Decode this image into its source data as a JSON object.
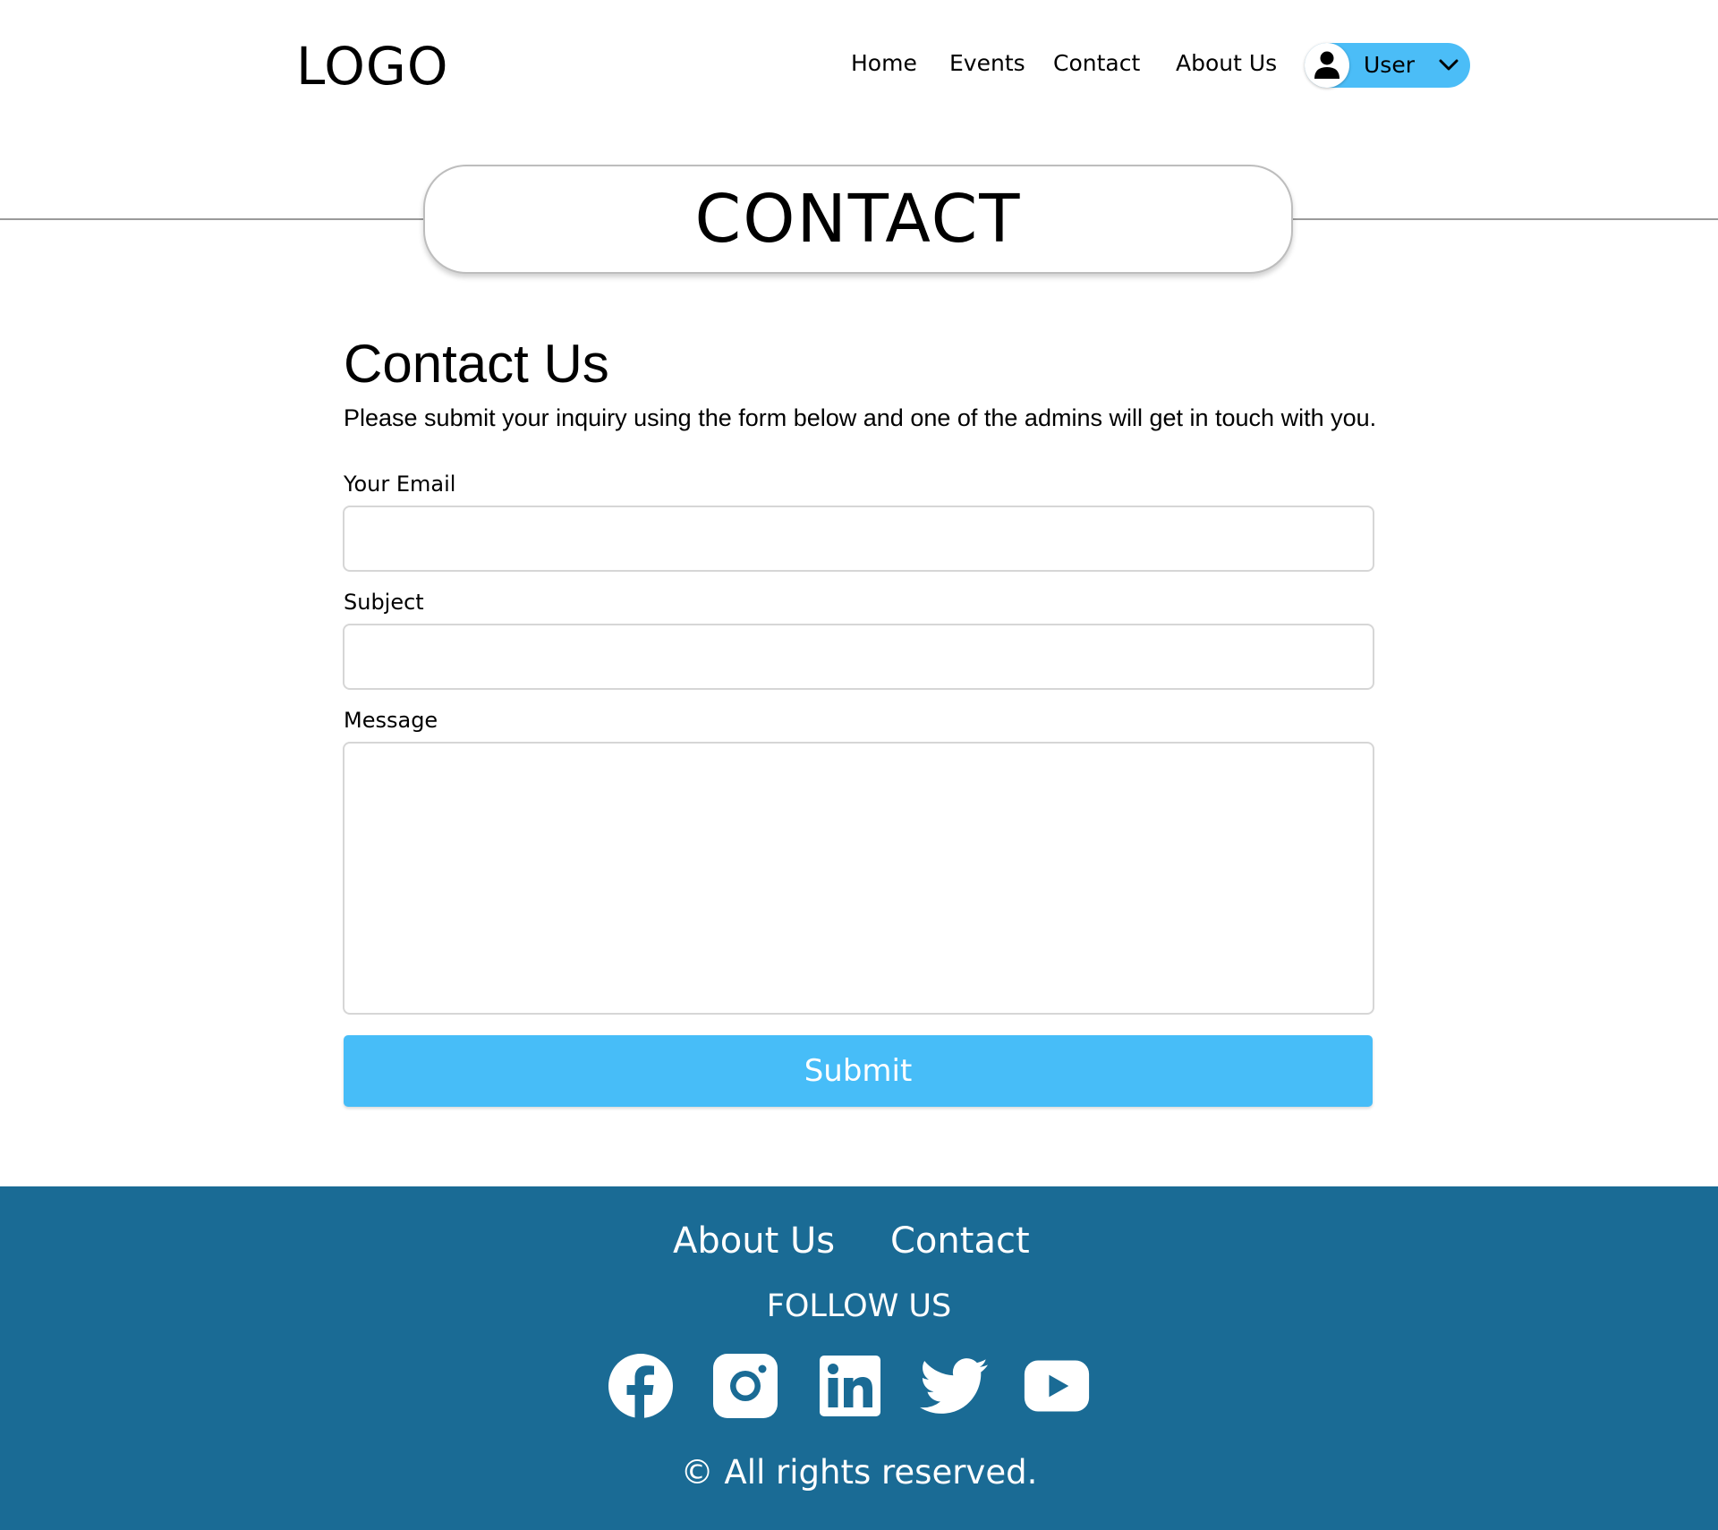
{
  "header": {
    "logo": "LOGO",
    "nav": [
      "Home",
      "Events",
      "Contact",
      "About Us"
    ],
    "user": {
      "label": "User"
    }
  },
  "page_title": "CONTACT",
  "form": {
    "heading": "Contact Us",
    "intro": "Please submit your inquiry using the form below and one of the admins will get in touch with you.",
    "email_label": "Your Email",
    "email_value": "",
    "subject_label": "Subject",
    "subject_value": "",
    "message_label": "Message",
    "message_value": "",
    "submit_label": "Submit"
  },
  "footer": {
    "links": [
      "About Us",
      "Contact"
    ],
    "follow_label": "FOLLOW US",
    "social_icons": [
      "facebook-icon",
      "instagram-icon",
      "linkedin-icon",
      "twitter-icon",
      "youtube-icon"
    ],
    "copyright": "© All rights reserved."
  },
  "colors": {
    "accent": "#47bdf8",
    "footer_bg": "#1a6b95",
    "text": "#000000"
  }
}
